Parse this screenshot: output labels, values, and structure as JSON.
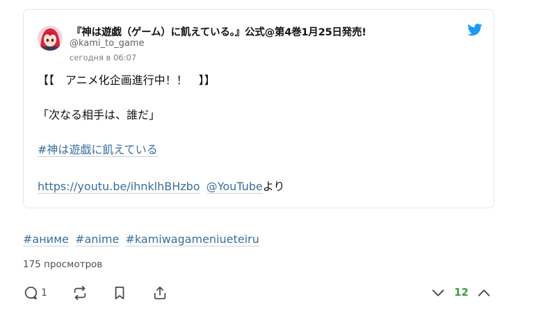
{
  "tweet": {
    "author_name": "『神は遊戯（ゲーム）に飢えている。』公式@第4巻1月25日発売!",
    "author_handle": "@kami_to_game",
    "timestamp": "сегодня в 06:07",
    "lines": {
      "line1": "【【　アニメ化企画進行中！！　】】",
      "line2": "「次なる相手は、誰だ」",
      "hashtag": "#神は遊戯に飢えている",
      "url": "https://youtu.be/ihnklhBHzbo",
      "mention": "@YouTube",
      "suffix": "より"
    },
    "source_icon": "twitter-bird-icon",
    "brand_color": "#1d9bf0"
  },
  "post": {
    "tags": [
      "#аниме",
      "#anime",
      "#kamiwagameniueteiru"
    ],
    "views": "175 просмотров"
  },
  "actions": {
    "comment_icon": "comment-icon",
    "comment_count": "1",
    "repost_icon": "repost-icon",
    "bookmark_icon": "bookmark-icon",
    "share_icon": "share-icon",
    "downvote_icon": "chevron-down-icon",
    "upvote_icon": "chevron-up-icon",
    "rating": "12",
    "rating_color": "#3f9d3f",
    "link_color": "#3a6e9c"
  }
}
